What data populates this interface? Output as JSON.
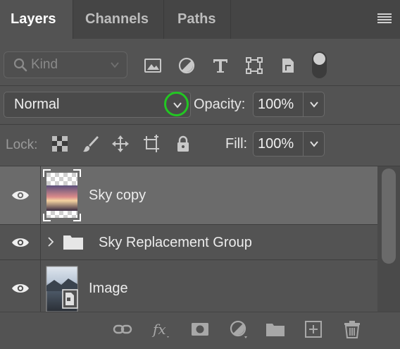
{
  "tabs": [
    {
      "label": "Layers",
      "active": true
    },
    {
      "label": "Channels",
      "active": false
    },
    {
      "label": "Paths",
      "active": false
    }
  ],
  "filter": {
    "kind_label": "Kind",
    "icons": [
      "image-filter-icon",
      "adjustment-filter-icon",
      "type-filter-icon",
      "shape-filter-icon",
      "smart-object-filter-icon"
    ]
  },
  "blend": {
    "mode": "Normal",
    "opacity_label": "Opacity:",
    "opacity_value": "100%"
  },
  "lock": {
    "label": "Lock:",
    "icons": [
      "lock-transparent-pixels-icon",
      "lock-image-pixels-icon",
      "lock-position-icon",
      "lock-artboard-icon",
      "lock-all-icon"
    ],
    "fill_label": "Fill:",
    "fill_value": "100%"
  },
  "layers": [
    {
      "name": "Sky copy",
      "type": "pixel",
      "selected": true,
      "visible": true
    },
    {
      "name": "Sky Replacement Group",
      "type": "group",
      "selected": false,
      "visible": true
    },
    {
      "name": "Image",
      "type": "smart-object",
      "selected": false,
      "visible": true
    }
  ],
  "bottom_icons": [
    "link-layers-icon",
    "fx-icon",
    "add-mask-icon",
    "adjustment-layer-icon",
    "new-group-icon",
    "new-layer-icon",
    "delete-layer-icon"
  ],
  "colors": {
    "panel_bg": "#535353",
    "selected_row": "#6b6b6b",
    "highlight_ring": "#22c722"
  }
}
